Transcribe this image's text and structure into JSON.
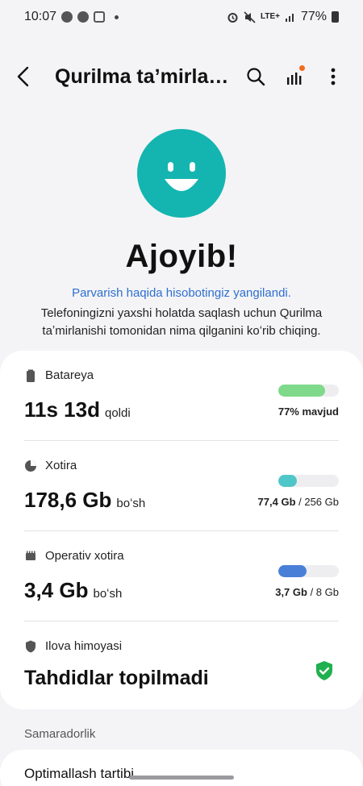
{
  "status_bar": {
    "time": "10:07",
    "network": "LTE+",
    "battery": "77%"
  },
  "app_bar": {
    "title": "Qurilma taʼmirla…"
  },
  "hero": {
    "title": "Ajoyib!",
    "link": "Parvarish haqida hisobotingiz yangilandi.",
    "description": "Telefoningizni yaxshi holatda saqlash uchun Qurilma taʼmirlanishi tomonidan nima qilganini koʻrib chiqing."
  },
  "items": [
    {
      "label": "Batareya",
      "value": "11s 13d",
      "unit": "qoldi",
      "right_bold": "77% mavjud",
      "right_rest": "",
      "fill": 0.77,
      "color": "#7fd98a"
    },
    {
      "label": "Xotira",
      "value": "178,6 Gb",
      "unit": "boʻsh",
      "right_bold": "77,4 Gb",
      "right_rest": " / 256 Gb",
      "fill": 0.3,
      "color": "#4fc6c8"
    },
    {
      "label": "Operativ xotira",
      "value": "3,4 Gb",
      "unit": "boʻsh",
      "right_bold": "3,7 Gb",
      "right_rest": " / 8 Gb",
      "fill": 0.46,
      "color": "#4a7fd8"
    },
    {
      "label": "Ilova himoyasi",
      "value": "Tahdidlar topilmadi",
      "unit": "",
      "right_bold": "",
      "right_rest": "",
      "color": "#1fb04f"
    }
  ],
  "section": {
    "label": "Samaradorlik",
    "next_item": "Optimallash tartibi"
  }
}
